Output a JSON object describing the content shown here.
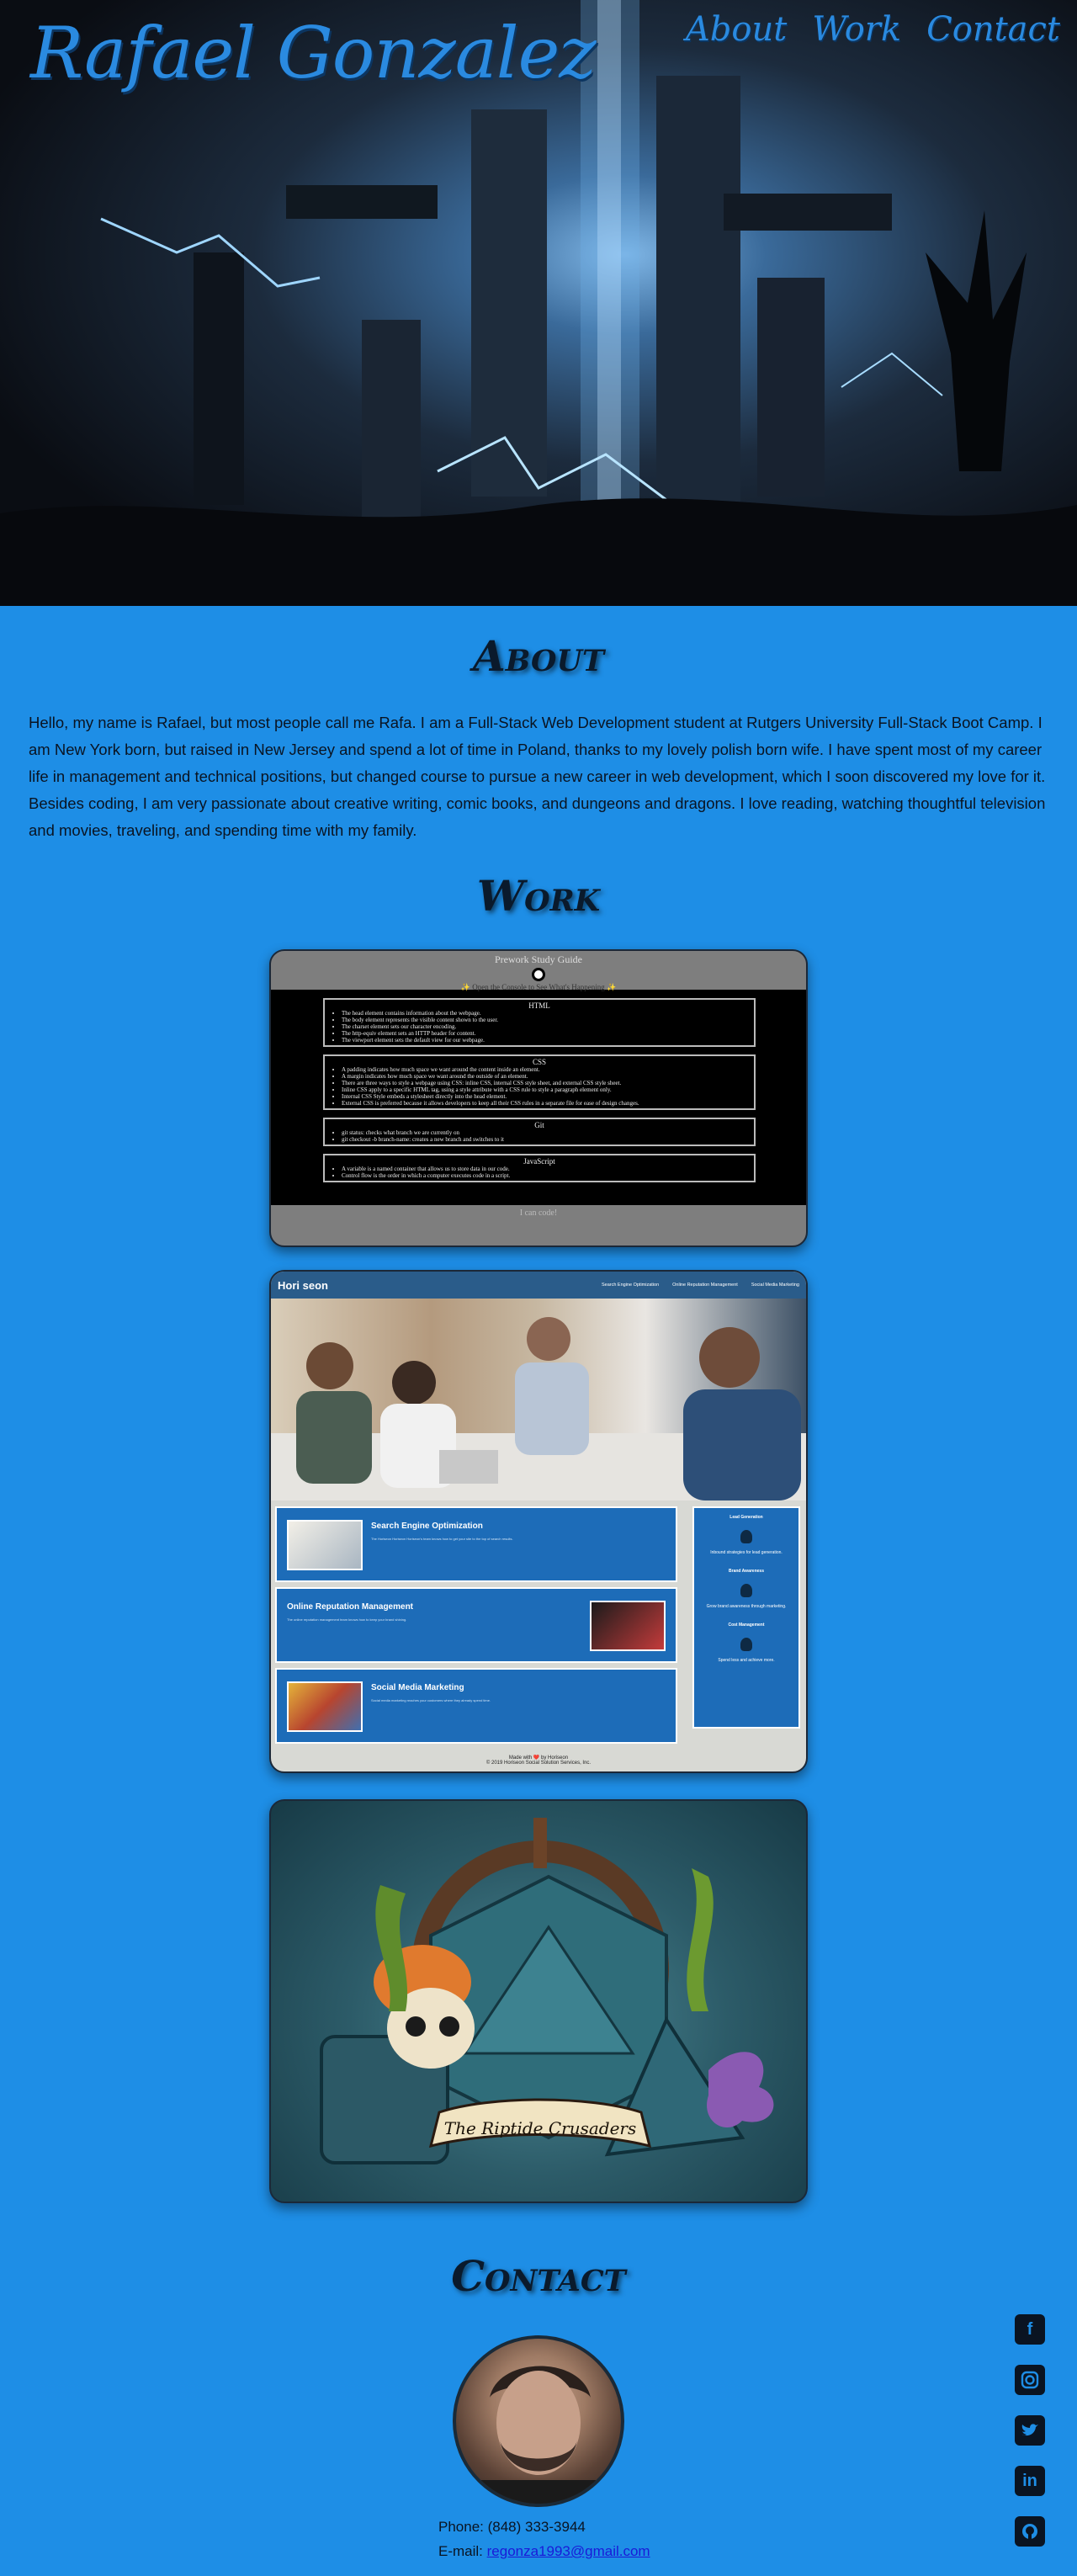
{
  "header": {
    "brand": "Rafael Gonzalez",
    "nav": [
      "About",
      "Work",
      "Contact"
    ]
  },
  "about": {
    "title": "About",
    "text": "Hello, my name is Rafael, but most people call me Rafa. I am a Full-Stack Web Development student at Rutgers University Full-Stack Boot Camp. I am New York born, but raised in New Jersey and spend a lot of time in Poland, thanks to my lovely polish born wife. I have spent most of my career life in management and technical positions, but changed course to pursue a new career in web development, which I soon discovered my love for it. Besides coding, I am very passionate about creative writing, comic books, and dungeons and dragons. I love reading, watching thoughtful television and movies, traveling, and spending time with my family."
  },
  "work": {
    "title": "Work",
    "prework": {
      "heading": "Prework Study Guide",
      "subheading": "✨ Open the Console to See What's Happening ✨",
      "sections": [
        {
          "title": "HTML",
          "items": [
            "The head element contains information about the webpage.",
            "The body element represents the visible content shown to the user.",
            "The charset element sets our character encoding.",
            "The http-equiv element sets an HTTP header for content.",
            "The viewport element sets the default view for our webpage."
          ]
        },
        {
          "title": "CSS",
          "items": [
            "A padding indicates how much space we want around the content inside an element.",
            "A margin indicates how much space we want around the outside of an element.",
            "There are three ways to style a webpage using CSS: inline CSS, internal CSS style sheet, and external CSS style sheet.",
            "Inline CSS apply to a specific HTML tag, using a style attribute with a CSS rule to style a paragraph element only.",
            "Internal CSS Style embeds a stylesheet directly into the head element.",
            "External CSS is preferred because it allows developers to keep all their CSS rules in a separate file for ease of design changes."
          ]
        },
        {
          "title": "Git",
          "items": [
            "git status: checks what branch we are currently on",
            "git checkout -b branch-name: creates a new branch and switches to it"
          ]
        },
        {
          "title": "JavaScript",
          "items": [
            "A variable is a named container that allows us to store data in our code.",
            "Control flow is the order in which a computer executes code in a script."
          ]
        }
      ],
      "footer": "I can code!"
    },
    "horiseon": {
      "logo": "Hori seon",
      "links": [
        "Search Engine Optimization",
        "Online Reputation Management",
        "Social Media Marketing"
      ],
      "items": [
        {
          "title": "Search Engine Optimization",
          "text": "The Horiseon Horiseon Horiseon's team knows how to get your site to the top of search results."
        },
        {
          "title": "Online Reputation Management",
          "text": "The online reputation management team knows how to keep your brand shining."
        },
        {
          "title": "Social Media Marketing",
          "text": "Social media marketing reaches your customers where they already spend time."
        }
      ],
      "aside": [
        {
          "title": "Lead Generation",
          "text": "Inbound strategies for lead generation."
        },
        {
          "title": "Brand Awareness",
          "text": "Grow brand awareness through marketing."
        },
        {
          "title": "Cost Management",
          "text": "Spend less and achieve more."
        }
      ],
      "footer_line1": "Made with ❤️ by Horiseon",
      "footer_line2": "© 2019 Horiseon Social Solution Services, Inc."
    },
    "riptide": {
      "banner": "The Riptide Crusaders"
    }
  },
  "contact": {
    "title": "Contact",
    "phone_label": "Phone: (848) 333-3944",
    "email_label": "E-mail: ",
    "email": "regonza1993@gmail.com",
    "social_icons": [
      "facebook-icon",
      "instagram-icon",
      "twitter-icon",
      "linkedin-icon",
      "github-icon"
    ]
  },
  "colors": {
    "background": "#1e8ee6",
    "brand": "#2a8ae0",
    "heading": "#0a1a2c"
  }
}
